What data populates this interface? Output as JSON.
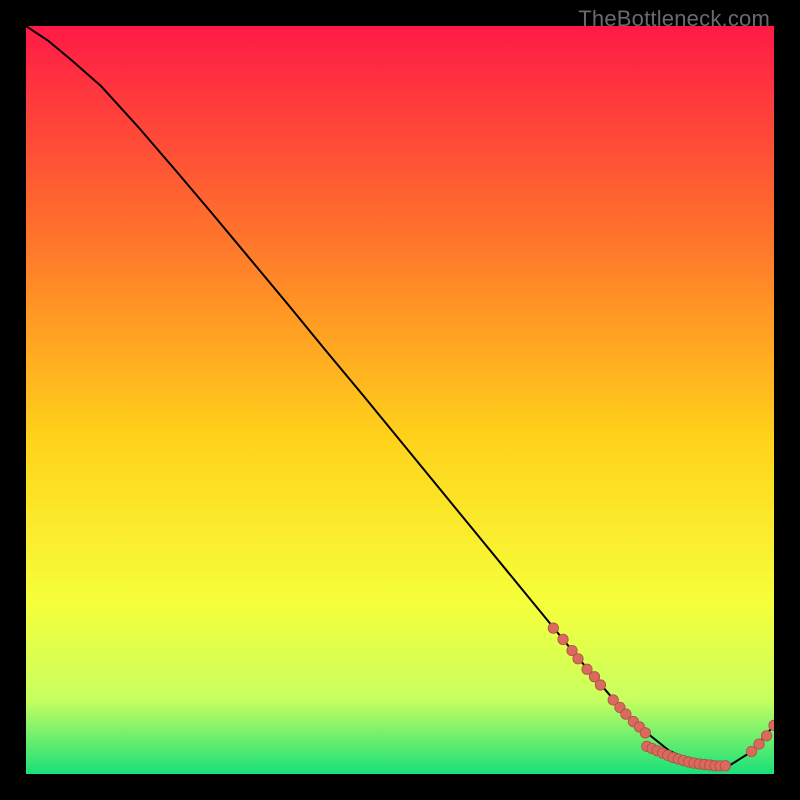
{
  "watermark": "TheBottleneck.com",
  "colors": {
    "gradient_top": "#ff1a46",
    "gradient_mid1": "#ff7a2a",
    "gradient_mid2": "#ffd21a",
    "gradient_mid3": "#f6ff3a",
    "gradient_mid4": "#c8ff60",
    "gradient_bottom": "#18e07a",
    "curve": "#000000",
    "marker_fill": "#d86a5e",
    "marker_stroke": "#b24e44",
    "frame": "#000000"
  },
  "chart_data": {
    "type": "line",
    "title": "",
    "xlabel": "",
    "ylabel": "",
    "xlim": [
      0,
      100
    ],
    "ylim": [
      0,
      100
    ],
    "series": [
      {
        "name": "curve",
        "x": [
          0,
          3,
          6,
          10,
          15,
          20,
          25,
          30,
          35,
          40,
          45,
          50,
          55,
          60,
          65,
          70,
          74,
          78,
          82,
          86,
          90,
          94,
          97,
          100
        ],
        "y": [
          100,
          98,
          95.5,
          92,
          86.5,
          80.7,
          74.8,
          68.8,
          62.8,
          56.7,
          50.7,
          44.6,
          38.5,
          32.4,
          26.3,
          20.2,
          15.3,
          10.6,
          6.3,
          3.1,
          1.3,
          1.1,
          3.0,
          6.5
        ]
      }
    ],
    "markers": [
      {
        "x": 70.5,
        "y": 19.5
      },
      {
        "x": 71.8,
        "y": 18.0
      },
      {
        "x": 73.0,
        "y": 16.5
      },
      {
        "x": 73.8,
        "y": 15.4
      },
      {
        "x": 75.0,
        "y": 14.0
      },
      {
        "x": 76.0,
        "y": 13.0
      },
      {
        "x": 76.8,
        "y": 11.9
      },
      {
        "x": 78.5,
        "y": 9.9
      },
      {
        "x": 79.4,
        "y": 8.9
      },
      {
        "x": 80.2,
        "y": 8.0
      },
      {
        "x": 81.2,
        "y": 7.0
      },
      {
        "x": 82.0,
        "y": 6.3
      },
      {
        "x": 82.8,
        "y": 5.5
      },
      {
        "x": 83.0,
        "y": 3.7
      },
      {
        "x": 83.7,
        "y": 3.4
      },
      {
        "x": 84.4,
        "y": 3.1
      },
      {
        "x": 85.1,
        "y": 2.8
      },
      {
        "x": 85.8,
        "y": 2.5
      },
      {
        "x": 86.5,
        "y": 2.2
      },
      {
        "x": 87.2,
        "y": 2.0
      },
      {
        "x": 87.9,
        "y": 1.8
      },
      {
        "x": 88.6,
        "y": 1.6
      },
      {
        "x": 89.3,
        "y": 1.45
      },
      {
        "x": 90.0,
        "y": 1.35
      },
      {
        "x": 90.7,
        "y": 1.27
      },
      {
        "x": 91.4,
        "y": 1.2
      },
      {
        "x": 92.1,
        "y": 1.1
      },
      {
        "x": 92.8,
        "y": 1.08
      },
      {
        "x": 93.5,
        "y": 1.1
      },
      {
        "x": 97.0,
        "y": 3.0
      },
      {
        "x": 98.0,
        "y": 4.0
      },
      {
        "x": 99.0,
        "y": 5.1
      },
      {
        "x": 100.0,
        "y": 6.5
      }
    ]
  }
}
